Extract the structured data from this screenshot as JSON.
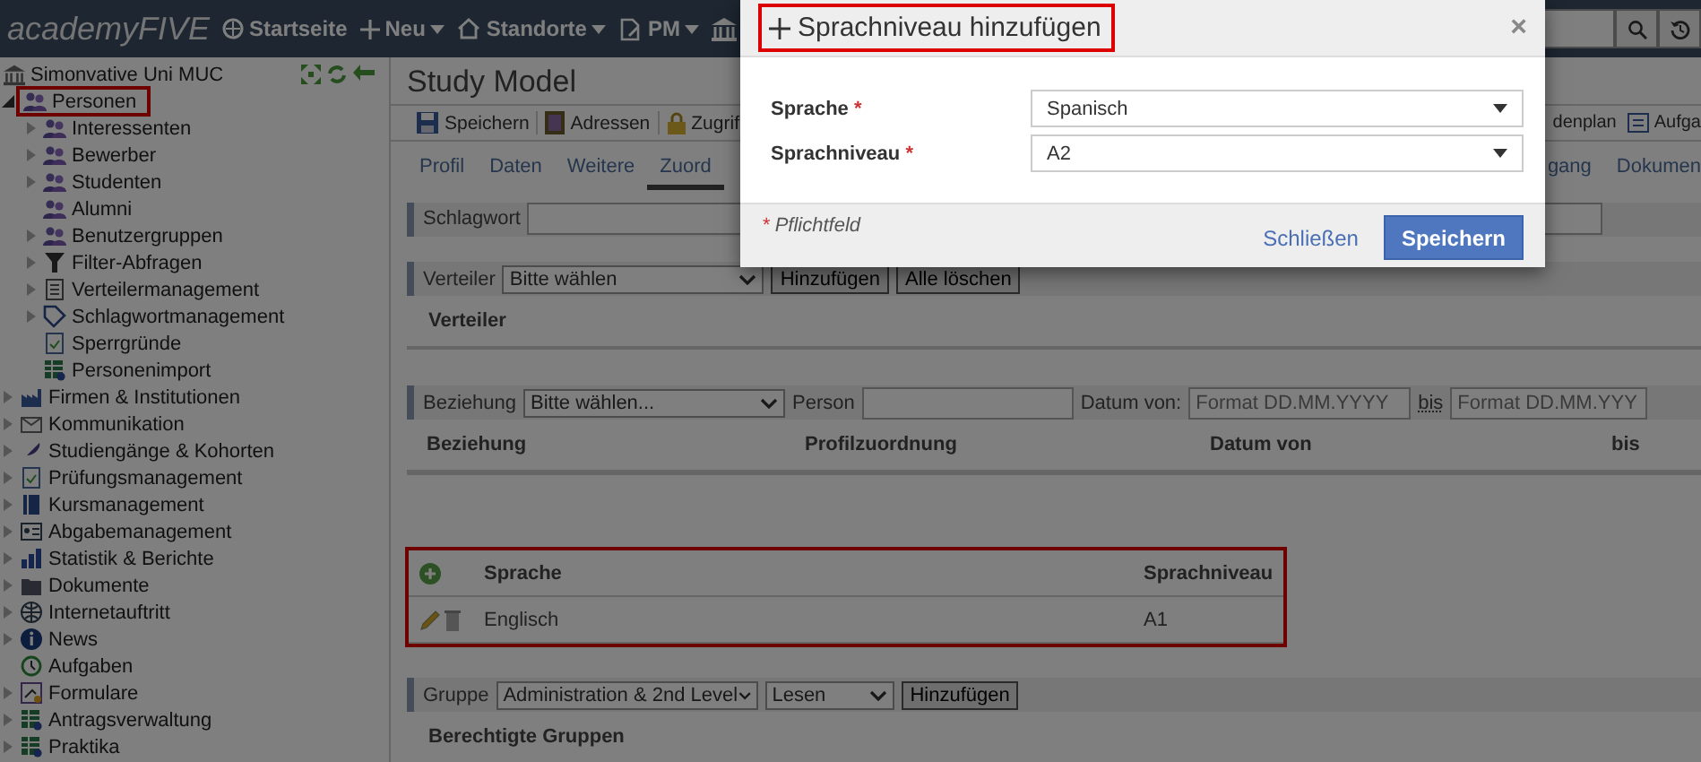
{
  "nav": {
    "logo": "academyFIVE",
    "items": [
      {
        "label": "Startseite",
        "dropdown": false
      },
      {
        "label": "Neu",
        "dropdown": true
      },
      {
        "label": "Standorte",
        "dropdown": true
      },
      {
        "label": "PM",
        "dropdown": true
      }
    ]
  },
  "sidebar": {
    "root": "Simonvative Uni MUC",
    "items": [
      {
        "label": "Personen",
        "expanded": true,
        "expandable": true,
        "highlighted": true,
        "children": [
          {
            "label": "Interessenten",
            "expandable": true,
            "expanded": false
          },
          {
            "label": "Bewerber",
            "expandable": true,
            "expanded": false
          },
          {
            "label": "Studenten",
            "expandable": true,
            "expanded": false
          },
          {
            "label": "Alumni",
            "expandable": false
          },
          {
            "label": "Benutzergruppen",
            "expandable": true,
            "expanded": false
          },
          {
            "label": "Filter-Abfragen",
            "expandable": true,
            "expanded": false
          },
          {
            "label": "Verteilermanagement",
            "expandable": true,
            "expanded": false
          },
          {
            "label": "Schlagwortmanagement",
            "expandable": true,
            "expanded": false
          },
          {
            "label": "Sperrgründe",
            "expandable": false
          },
          {
            "label": "Personenimport",
            "expandable": false
          }
        ]
      },
      {
        "label": "Firmen & Institutionen",
        "expandable": true,
        "expanded": false
      },
      {
        "label": "Kommunikation",
        "expandable": true,
        "expanded": false
      },
      {
        "label": "Studiengänge & Kohorten",
        "expandable": true,
        "expanded": false
      },
      {
        "label": "Prüfungsmanagement",
        "expandable": true,
        "expanded": false
      },
      {
        "label": "Kursmanagement",
        "expandable": true,
        "expanded": false
      },
      {
        "label": "Abgabemanagement",
        "expandable": true,
        "expanded": false
      },
      {
        "label": "Statistik & Berichte",
        "expandable": true,
        "expanded": false
      },
      {
        "label": "Dokumente",
        "expandable": true,
        "expanded": false
      },
      {
        "label": "Internetauftritt",
        "expandable": true,
        "expanded": false
      },
      {
        "label": "News",
        "expandable": true,
        "expanded": false
      },
      {
        "label": "Aufgaben",
        "expandable": false
      },
      {
        "label": "Formulare",
        "expandable": true,
        "expanded": false
      },
      {
        "label": "Antragsverwaltung",
        "expandable": true,
        "expanded": false
      },
      {
        "label": "Praktika",
        "expandable": true,
        "expanded": false
      }
    ]
  },
  "page": {
    "title": "Study Model",
    "toolbar_left": [
      "Speichern",
      "Adressen",
      "Zugrif"
    ],
    "toolbar_right": [
      "denplan",
      "Aufga"
    ],
    "tabs_left": [
      {
        "label": "Profil",
        "selected": false
      },
      {
        "label": "Daten",
        "selected": false
      },
      {
        "label": "Weitere",
        "selected": false
      },
      {
        "label": "Zuord",
        "selected": true
      }
    ],
    "tabs_right": [
      {
        "label": "gang",
        "selected": false
      },
      {
        "label": "Dokumen",
        "selected": false
      }
    ],
    "schlagwort": {
      "label": "Schlagwort"
    },
    "verteiler": {
      "label": "Verteiler",
      "select": "Bitte wählen",
      "buttons": [
        "Hinzufügen",
        "Alle löschen"
      ],
      "heading": "Verteiler"
    },
    "beziehung": {
      "label": "Beziehung",
      "select": "Bitte wählen...",
      "person_label": "Person",
      "from_label": "Datum von:",
      "from_placeholder": "Format DD.MM.YYYY",
      "to_label": "bis",
      "to_placeholder": "Format DD.MM.YYY",
      "columns": [
        "Beziehung",
        "Profilzuordnung",
        "Datum von",
        "bis"
      ]
    },
    "languages": {
      "highlighted": true,
      "columns": [
        "Sprache",
        "Sprachniveau"
      ],
      "rows": [
        {
          "language": "Englisch",
          "level": "A1"
        }
      ]
    },
    "gruppe": {
      "label": "Gruppe",
      "select": "Administration & 2nd Level",
      "select2": "Lesen",
      "button": "Hinzufügen",
      "heading": "Berechtigte Gruppen"
    }
  },
  "modal": {
    "open": true,
    "title": "Sprachniveau hinzufügen",
    "highlighted": true,
    "close": "×",
    "required_mark": "*",
    "fields": [
      {
        "label": "Sprache",
        "required": true,
        "value": "Spanisch"
      },
      {
        "label": "Sprachniveau",
        "required": true,
        "value": "A2"
      }
    ],
    "footnote_mark": "*",
    "footnote": "Pflichtfeld",
    "cancel": "Schließen",
    "save": "Speichern"
  }
}
